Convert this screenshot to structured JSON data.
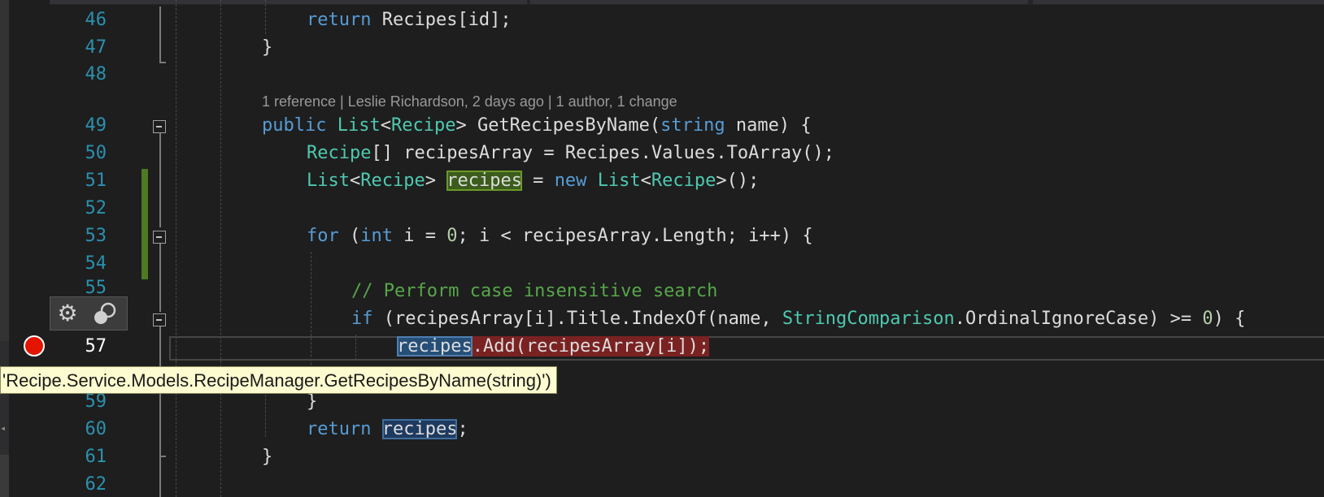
{
  "editor": {
    "codelens": "1 reference | Leslie Richardson, 2 days ago | 1 author, 1 change",
    "line_numbers": [
      "46",
      "47",
      "48",
      "49",
      "50",
      "51",
      "52",
      "53",
      "54",
      "55",
      "57",
      "59",
      "60",
      "61",
      "62"
    ],
    "lines": {
      "l46": {
        "t1": "return",
        "t2": " Recipes[id];"
      },
      "l47": {
        "t1": "}"
      },
      "l49": {
        "t1": "public",
        "t2": " ",
        "t3": "List",
        "t4": "<",
        "t5": "Recipe",
        "t6": "> GetRecipesByName(",
        "t7": "string",
        "t8": " name) {"
      },
      "l50": {
        "t1": "Recipe",
        "t2": "[] recipesArray = Recipes.Values.ToArray();"
      },
      "l51": {
        "t1": "List",
        "t2": "<",
        "t3": "Recipe",
        "t4": "> ",
        "t5": "recipes",
        "t6": " = ",
        "t7": "new",
        "t8": " ",
        "t9": "List",
        "t10": "<",
        "t11": "Recipe",
        "t12": ">();"
      },
      "l53": {
        "t1": "for",
        "t2": " (",
        "t3": "int",
        "t4": " i = ",
        "t5": "0",
        "t6": "; i < recipesArray.Length; i++) {"
      },
      "l55": {
        "t1": "// Perform case insensitive search"
      },
      "l56": {
        "t1": "if",
        "t2": " (recipesArray[i].Title.IndexOf(name, ",
        "t3": "StringComparison",
        "t4": ".OrdinalIgnoreCase) >= ",
        "t5": "0",
        "t6": ") {"
      },
      "l57": {
        "t1": "recipes",
        "t2": ".Add(recipesArray[i]);"
      },
      "l59": {
        "t1": "}"
      },
      "l60": {
        "t1": "return",
        "t2": " ",
        "t3": "recipes",
        "t4": ";"
      },
      "l61": {
        "t1": "}"
      }
    }
  },
  "tooltip": {
    "text": "'Recipe.Service.Models.RecipeManager.GetRecipesByName(string)')"
  },
  "quick_actions": {
    "settings_icon": "gear-icon",
    "breakpoint_settings_icon": "breakpoint-conditions-icon"
  },
  "colors": {
    "background": "#1e1e1e",
    "line_number": "#2b91af",
    "keyword": "#569cd6",
    "type": "#4ec9b0",
    "comment": "#57a64a",
    "breakpoint": "#e51400",
    "tooltip_bg": "#fdfbd0"
  }
}
